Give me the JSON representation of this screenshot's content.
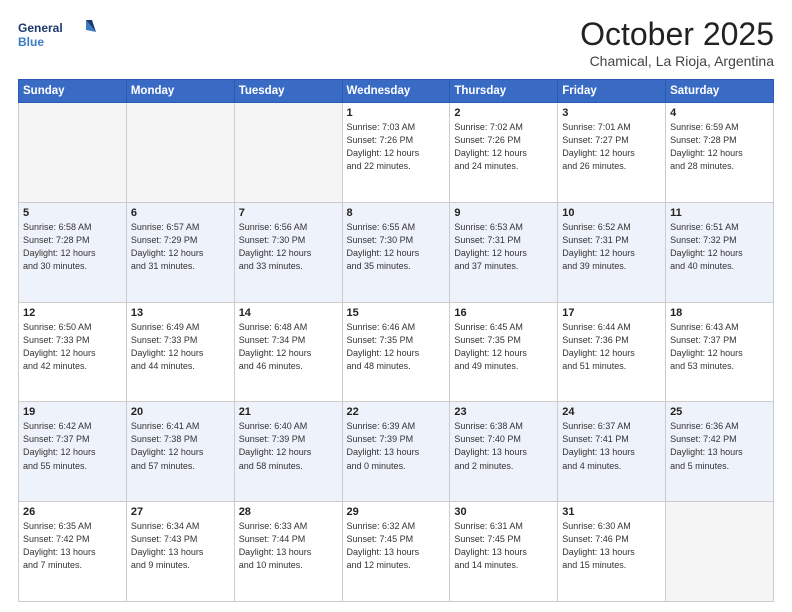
{
  "header": {
    "logo_line1": "General",
    "logo_line2": "Blue",
    "month": "October 2025",
    "location": "Chamical, La Rioja, Argentina"
  },
  "weekdays": [
    "Sunday",
    "Monday",
    "Tuesday",
    "Wednesday",
    "Thursday",
    "Friday",
    "Saturday"
  ],
  "weeks": [
    [
      {
        "day": "",
        "info": ""
      },
      {
        "day": "",
        "info": ""
      },
      {
        "day": "",
        "info": ""
      },
      {
        "day": "1",
        "info": "Sunrise: 7:03 AM\nSunset: 7:26 PM\nDaylight: 12 hours\nand 22 minutes."
      },
      {
        "day": "2",
        "info": "Sunrise: 7:02 AM\nSunset: 7:26 PM\nDaylight: 12 hours\nand 24 minutes."
      },
      {
        "day": "3",
        "info": "Sunrise: 7:01 AM\nSunset: 7:27 PM\nDaylight: 12 hours\nand 26 minutes."
      },
      {
        "day": "4",
        "info": "Sunrise: 6:59 AM\nSunset: 7:28 PM\nDaylight: 12 hours\nand 28 minutes."
      }
    ],
    [
      {
        "day": "5",
        "info": "Sunrise: 6:58 AM\nSunset: 7:28 PM\nDaylight: 12 hours\nand 30 minutes."
      },
      {
        "day": "6",
        "info": "Sunrise: 6:57 AM\nSunset: 7:29 PM\nDaylight: 12 hours\nand 31 minutes."
      },
      {
        "day": "7",
        "info": "Sunrise: 6:56 AM\nSunset: 7:30 PM\nDaylight: 12 hours\nand 33 minutes."
      },
      {
        "day": "8",
        "info": "Sunrise: 6:55 AM\nSunset: 7:30 PM\nDaylight: 12 hours\nand 35 minutes."
      },
      {
        "day": "9",
        "info": "Sunrise: 6:53 AM\nSunset: 7:31 PM\nDaylight: 12 hours\nand 37 minutes."
      },
      {
        "day": "10",
        "info": "Sunrise: 6:52 AM\nSunset: 7:31 PM\nDaylight: 12 hours\nand 39 minutes."
      },
      {
        "day": "11",
        "info": "Sunrise: 6:51 AM\nSunset: 7:32 PM\nDaylight: 12 hours\nand 40 minutes."
      }
    ],
    [
      {
        "day": "12",
        "info": "Sunrise: 6:50 AM\nSunset: 7:33 PM\nDaylight: 12 hours\nand 42 minutes."
      },
      {
        "day": "13",
        "info": "Sunrise: 6:49 AM\nSunset: 7:33 PM\nDaylight: 12 hours\nand 44 minutes."
      },
      {
        "day": "14",
        "info": "Sunrise: 6:48 AM\nSunset: 7:34 PM\nDaylight: 12 hours\nand 46 minutes."
      },
      {
        "day": "15",
        "info": "Sunrise: 6:46 AM\nSunset: 7:35 PM\nDaylight: 12 hours\nand 48 minutes."
      },
      {
        "day": "16",
        "info": "Sunrise: 6:45 AM\nSunset: 7:35 PM\nDaylight: 12 hours\nand 49 minutes."
      },
      {
        "day": "17",
        "info": "Sunrise: 6:44 AM\nSunset: 7:36 PM\nDaylight: 12 hours\nand 51 minutes."
      },
      {
        "day": "18",
        "info": "Sunrise: 6:43 AM\nSunset: 7:37 PM\nDaylight: 12 hours\nand 53 minutes."
      }
    ],
    [
      {
        "day": "19",
        "info": "Sunrise: 6:42 AM\nSunset: 7:37 PM\nDaylight: 12 hours\nand 55 minutes."
      },
      {
        "day": "20",
        "info": "Sunrise: 6:41 AM\nSunset: 7:38 PM\nDaylight: 12 hours\nand 57 minutes."
      },
      {
        "day": "21",
        "info": "Sunrise: 6:40 AM\nSunset: 7:39 PM\nDaylight: 12 hours\nand 58 minutes."
      },
      {
        "day": "22",
        "info": "Sunrise: 6:39 AM\nSunset: 7:39 PM\nDaylight: 13 hours\nand 0 minutes."
      },
      {
        "day": "23",
        "info": "Sunrise: 6:38 AM\nSunset: 7:40 PM\nDaylight: 13 hours\nand 2 minutes."
      },
      {
        "day": "24",
        "info": "Sunrise: 6:37 AM\nSunset: 7:41 PM\nDaylight: 13 hours\nand 4 minutes."
      },
      {
        "day": "25",
        "info": "Sunrise: 6:36 AM\nSunset: 7:42 PM\nDaylight: 13 hours\nand 5 minutes."
      }
    ],
    [
      {
        "day": "26",
        "info": "Sunrise: 6:35 AM\nSunset: 7:42 PM\nDaylight: 13 hours\nand 7 minutes."
      },
      {
        "day": "27",
        "info": "Sunrise: 6:34 AM\nSunset: 7:43 PM\nDaylight: 13 hours\nand 9 minutes."
      },
      {
        "day": "28",
        "info": "Sunrise: 6:33 AM\nSunset: 7:44 PM\nDaylight: 13 hours\nand 10 minutes."
      },
      {
        "day": "29",
        "info": "Sunrise: 6:32 AM\nSunset: 7:45 PM\nDaylight: 13 hours\nand 12 minutes."
      },
      {
        "day": "30",
        "info": "Sunrise: 6:31 AM\nSunset: 7:45 PM\nDaylight: 13 hours\nand 14 minutes."
      },
      {
        "day": "31",
        "info": "Sunrise: 6:30 AM\nSunset: 7:46 PM\nDaylight: 13 hours\nand 15 minutes."
      },
      {
        "day": "",
        "info": ""
      }
    ]
  ]
}
